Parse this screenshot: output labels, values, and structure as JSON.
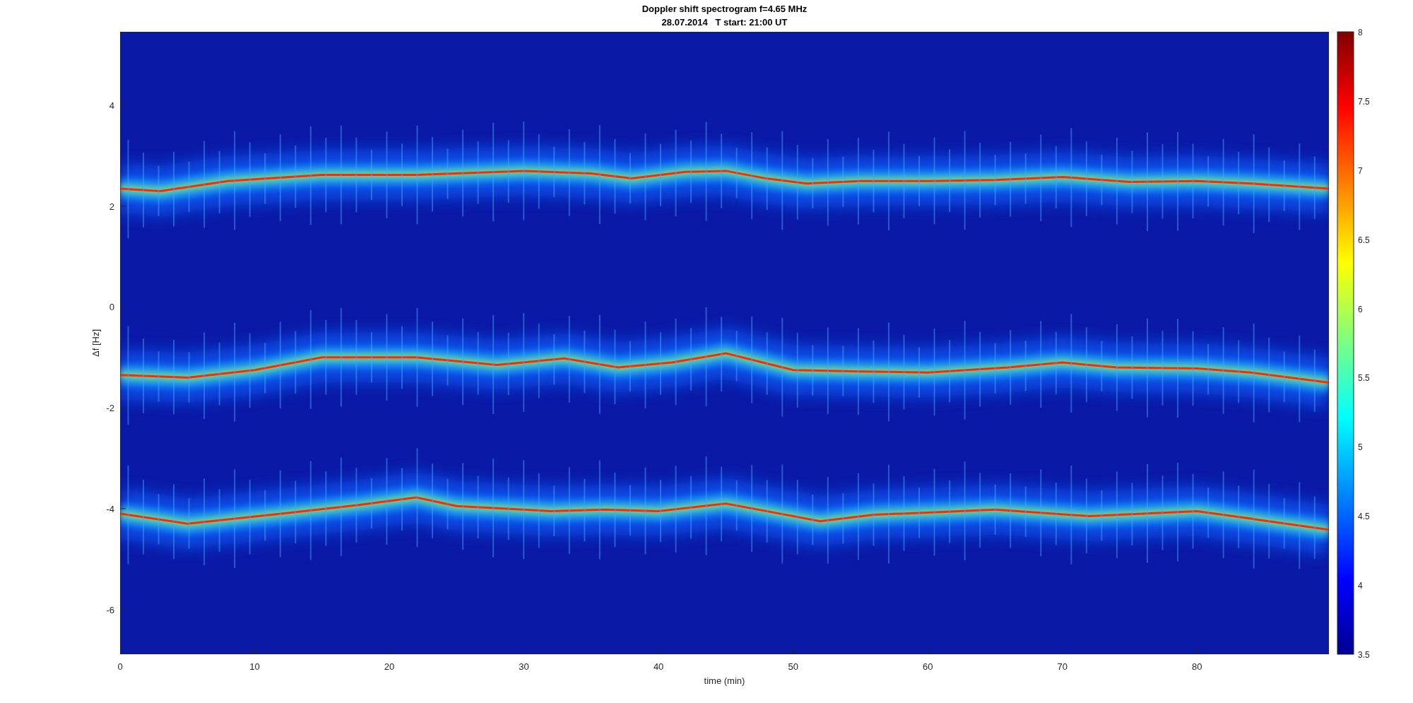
{
  "figure": {
    "title": "Doppler shift spectrogram f=4.65 MHz",
    "subtitle": "28.07.2014   T start: 21:00 UT",
    "xlabel": "time (min)",
    "ylabel": "Δf [Hz]",
    "xticks": [
      "0",
      "10",
      "20",
      "30",
      "40",
      "50",
      "60",
      "70",
      "80"
    ],
    "yticks": [
      "4",
      "2",
      "0",
      "-2",
      "-4",
      "-6"
    ],
    "colorbar_ticks": [
      "8",
      "7.5",
      "7",
      "6.5",
      "6",
      "5.5",
      "5",
      "4.5",
      "4",
      "3.5"
    ]
  }
}
